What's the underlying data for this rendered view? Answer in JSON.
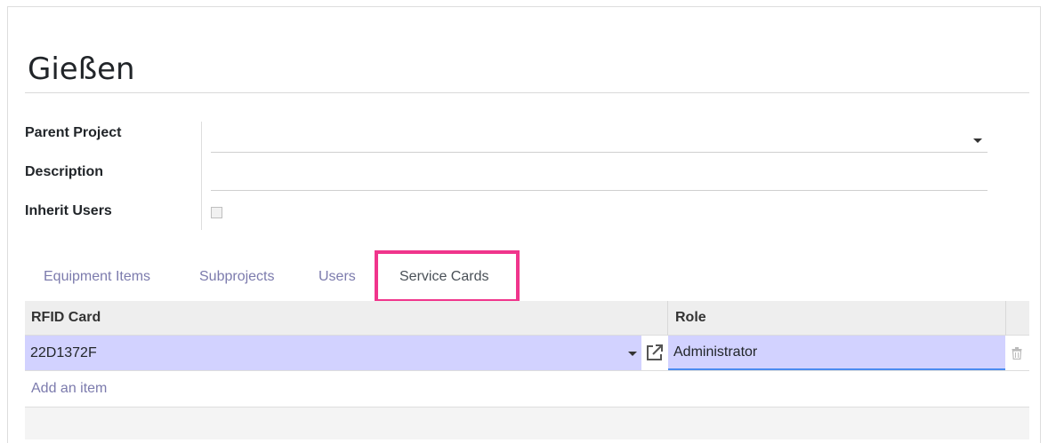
{
  "record": {
    "title": "Gießen"
  },
  "form": {
    "parent_project": {
      "label": "Parent Project",
      "value": ""
    },
    "description": {
      "label": "Description",
      "value": ""
    },
    "inherit_users": {
      "label": "Inherit Users",
      "checked": false
    }
  },
  "tabs": [
    {
      "label": "Equipment Items",
      "active": false
    },
    {
      "label": "Subprojects",
      "active": false
    },
    {
      "label": "Users",
      "active": false
    },
    {
      "label": "Service Cards",
      "active": true
    }
  ],
  "table": {
    "columns": [
      "RFID Card",
      "Role"
    ],
    "rows": [
      {
        "rfid_card": "22D1372F",
        "role": "Administrator"
      }
    ],
    "add_item_label": "Add an item"
  },
  "colors": {
    "accent": "#7c7bad",
    "highlight_box": "#f0358c",
    "row_selected": "#d2d2ff",
    "focus_underline": "#4c8cf0"
  },
  "icons": {
    "dropdown": "caret-down-icon",
    "external_link": "external-link-icon",
    "delete": "trash-icon"
  }
}
